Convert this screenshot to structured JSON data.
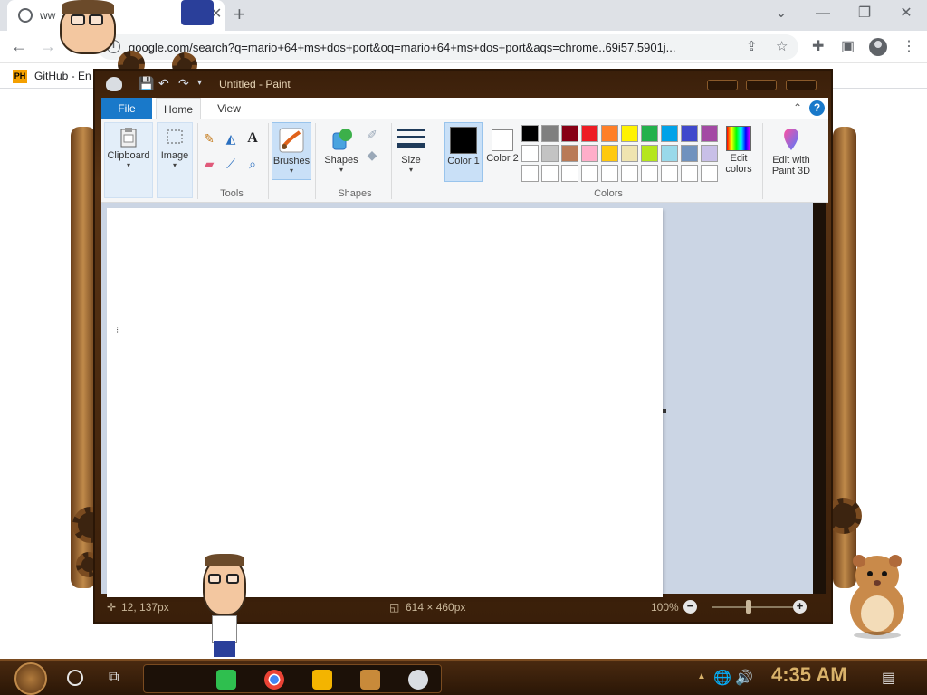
{
  "browser": {
    "tab_title": "ww",
    "tab_close": "✕",
    "new_tab": "+",
    "window_controls": {
      "minimize": "—",
      "restore": "❐",
      "close": "✕",
      "tab_search": "⌄"
    },
    "nav": {
      "back": "←",
      "forward": "→"
    },
    "omnibox_url": "google.com/search?q=mario+64+ms+dos+port&oq=mario+64+ms+dos+port&aqs=chrome..69i57.5901j...",
    "bookmark": {
      "icon_text": "PH",
      "label": "GitHub - En"
    }
  },
  "paint": {
    "title": "Untitled - Paint",
    "tabs": {
      "file": "File",
      "home": "Home",
      "view": "View"
    },
    "help": "?",
    "collapse": "⌃",
    "ribbon": {
      "clipboard": "Clipboard",
      "image": "Image",
      "tools": "Tools",
      "brushes": "Brushes",
      "shapes_btn": "Shapes",
      "shapes_group": "Shapes",
      "size": "Size",
      "color1": "Color 1",
      "color2": "Color 2",
      "colors": "Colors",
      "edit_colors": "Edit colors",
      "edit_paint3d": "Edit with Paint 3D",
      "dropdown_arrow": "▾"
    },
    "palette": [
      "#000000",
      "#7f7f7f",
      "#880015",
      "#ed1c24",
      "#ff7f27",
      "#fff200",
      "#22b14c",
      "#00a2e8",
      "#3f48cc",
      "#a349a4",
      "#ffffff",
      "#c3c3c3",
      "#b97a57",
      "#ffaec9",
      "#ffc90e",
      "#efe4b0",
      "#b5e61d",
      "#99d9ea",
      "#7092be",
      "#c8bfe7",
      "#ffffff",
      "#ffffff",
      "#ffffff",
      "#ffffff",
      "#ffffff",
      "#ffffff",
      "#ffffff",
      "#ffffff",
      "#ffffff",
      "#ffffff"
    ],
    "color1_value": "#000000",
    "color2_value": "#ffffff",
    "status": {
      "cursor_pos": "12, 137px",
      "canvas_size": "614 × 460px",
      "zoom": "100%",
      "zoom_minus": "−",
      "zoom_plus": "+"
    }
  },
  "taskbar": {
    "clock": "4:35 AM"
  }
}
